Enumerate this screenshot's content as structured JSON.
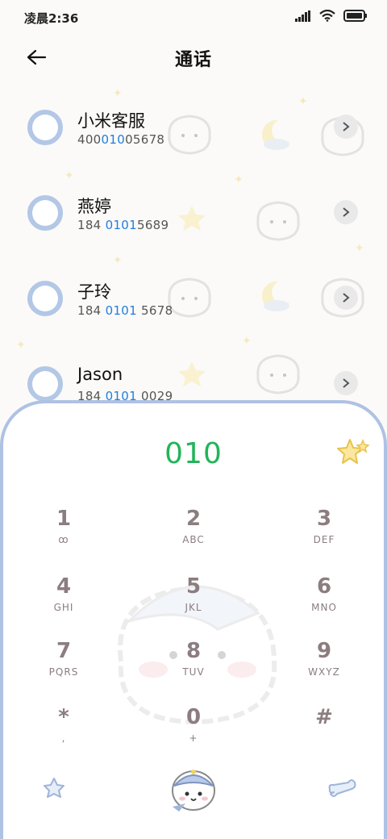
{
  "status_bar": {
    "time": "凌晨2:36",
    "icons": [
      "signal-icon",
      "wifi-icon",
      "battery-icon"
    ]
  },
  "header": {
    "title": "通话",
    "back_icon": "arrow-left-icon"
  },
  "contacts": [
    {
      "name": "小米客服",
      "number_pre": "400",
      "number_match": "010",
      "number_post": "05678"
    },
    {
      "name": "燕婷",
      "number_pre": "184 ",
      "number_match": "0101",
      "number_post": "5689"
    },
    {
      "name": "子玲",
      "number_pre": "184 ",
      "number_match": "0101",
      "number_post": " 5678"
    },
    {
      "name": "Jason",
      "number_pre": "184 ",
      "number_match": "0101",
      "number_post": " 0029"
    }
  ],
  "dialpad": {
    "entered_number": "010",
    "keys": [
      {
        "digit": "1",
        "letters": "ꝏ"
      },
      {
        "digit": "2",
        "letters": "ABC"
      },
      {
        "digit": "3",
        "letters": "DEF"
      },
      {
        "digit": "4",
        "letters": "GHI"
      },
      {
        "digit": "5",
        "letters": "JKL"
      },
      {
        "digit": "6",
        "letters": "MNO"
      },
      {
        "digit": "7",
        "letters": "PQRS"
      },
      {
        "digit": "8",
        "letters": "TUV"
      },
      {
        "digit": "9",
        "letters": "WXYZ"
      },
      {
        "digit": "*",
        "letters": ","
      },
      {
        "digit": "0",
        "letters": "+"
      },
      {
        "digit": "#",
        "letters": ""
      }
    ]
  },
  "colors": {
    "accent_green": "#22b45a",
    "match_blue": "#1e7fe0",
    "dialpad_border": "#aec2e4",
    "key_text": "#8b7d80"
  }
}
